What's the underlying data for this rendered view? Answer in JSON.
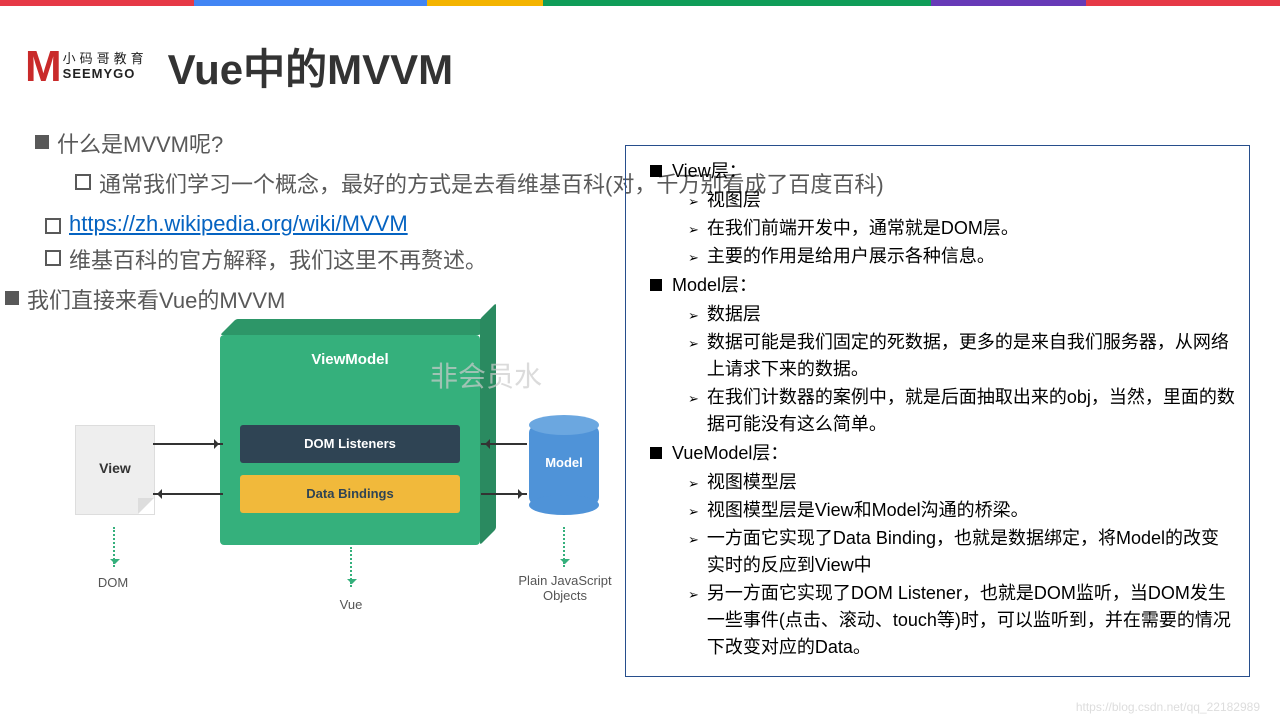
{
  "stripe_colors": [
    "#e63946",
    "#4285f4",
    "#f4b400",
    "#0f9d58",
    "#673ab7",
    "#e63946"
  ],
  "logo": {
    "cn": "小码哥教育",
    "en": "SEEMYGO"
  },
  "title": "Vue中的MVVM",
  "bullets": {
    "q1": "什么是MVVM呢?",
    "q1_sub1": "通常我们学习一个概念，最好的方式是去看维基百科(对，千万别看成了百度百科)",
    "q1_link": "https://zh.wikipedia.org/wiki/MVVM",
    "q1_sub3": "维基百科的官方解释，我们这里不再赘述。",
    "q2": "我们直接来看Vue的MVVM"
  },
  "diagram": {
    "vm_title": "ViewModel",
    "dom_listeners": "DOM Listeners",
    "data_bindings": "Data Bindings",
    "view": "View",
    "model": "Model",
    "cap_dom": "DOM",
    "cap_vue": "Vue",
    "cap_obj": "Plain JavaScript\nObjects"
  },
  "right": {
    "view_h": "View层：",
    "view_i": [
      "视图层",
      "在我们前端开发中，通常就是DOM层。",
      "主要的作用是给用户展示各种信息。"
    ],
    "model_h": "Model层：",
    "model_i": [
      "数据层",
      "数据可能是我们固定的死数据，更多的是来自我们服务器，从网络上请求下来的数据。",
      "在我们计数器的案例中，就是后面抽取出来的obj，当然，里面的数据可能没有这么简单。"
    ],
    "vm_h": "VueModel层：",
    "vm_i": [
      "视图模型层",
      "视图模型层是View和Model沟通的桥梁。",
      "一方面它实现了Data Binding，也就是数据绑定，将Model的改变实时的反应到View中",
      "另一方面它实现了DOM Listener，也就是DOM监听，当DOM发生一些事件(点击、滚动、touch等)时，可以监听到，并在需要的情况下改变对应的Data。"
    ]
  },
  "watermark": "非会员水",
  "footer_wm": "https://blog.csdn.net/qq_22182989"
}
